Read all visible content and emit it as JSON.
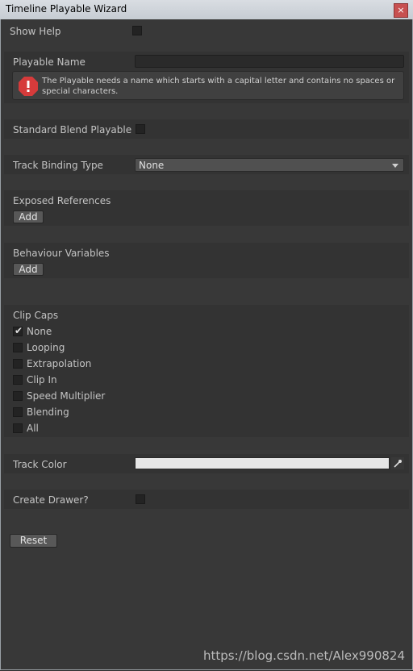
{
  "window": {
    "title": "Timeline Playable Wizard",
    "close_glyph": "×"
  },
  "show_help": {
    "label": "Show Help",
    "checked": false
  },
  "playable_name": {
    "label": "Playable Name",
    "value": "",
    "warning": "The Playable needs a name which starts with a capital letter and contains no spaces or special characters."
  },
  "standard_blend": {
    "label": "Standard Blend Playable",
    "checked": false
  },
  "track_binding": {
    "label": "Track Binding Type",
    "value": "None"
  },
  "exposed_references": {
    "label": "Exposed References",
    "add_label": "Add"
  },
  "behaviour_variables": {
    "label": "Behaviour Variables",
    "add_label": "Add"
  },
  "clip_caps": {
    "label": "Clip Caps",
    "items": [
      {
        "label": "None",
        "checked": true
      },
      {
        "label": "Looping",
        "checked": false
      },
      {
        "label": "Extrapolation",
        "checked": false
      },
      {
        "label": "Clip In",
        "checked": false
      },
      {
        "label": "Speed Multiplier",
        "checked": false
      },
      {
        "label": "Blending",
        "checked": false
      },
      {
        "label": "All",
        "checked": false
      }
    ]
  },
  "track_color": {
    "label": "Track Color",
    "value": "#e6e6e6"
  },
  "create_drawer": {
    "label": "Create Drawer?",
    "checked": false
  },
  "reset_label": "Reset",
  "watermark": "https://blog.csdn.net/Alex990824"
}
